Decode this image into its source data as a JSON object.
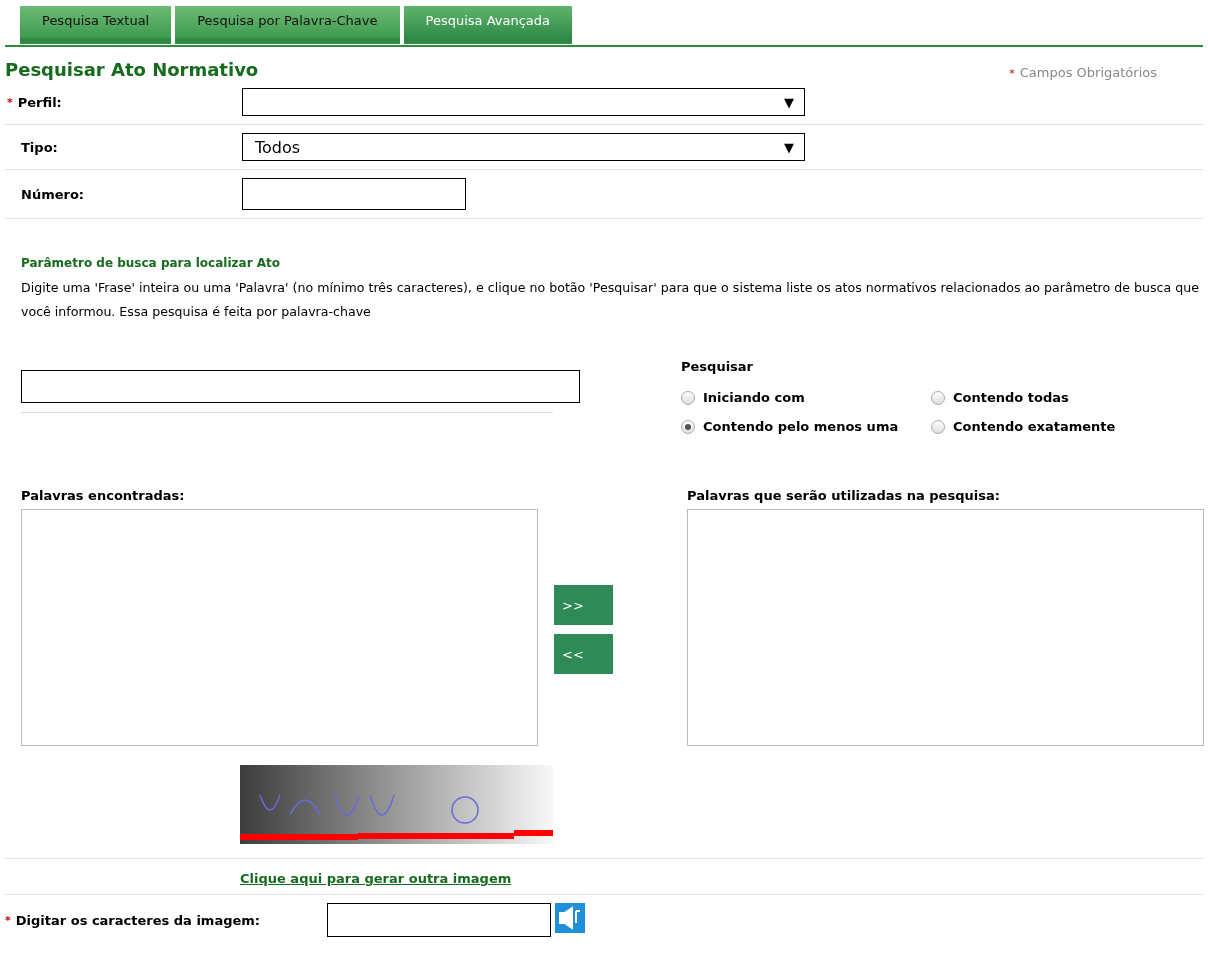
{
  "tabs": [
    {
      "label": "Pesquisa Textual",
      "selected": false
    },
    {
      "label": "Pesquisa por Palavra-Chave",
      "selected": false
    },
    {
      "label": "Pesquisa Avançada",
      "selected": true
    }
  ],
  "title": "Pesquisar Ato Normativo",
  "required_note": {
    "mark": "*",
    "text": "Campos Obrigatórios"
  },
  "fields": [
    {
      "label": "Perfil:",
      "required": true,
      "kind": "select",
      "arrow": "▼"
    },
    {
      "label": "Tipo:",
      "required": false,
      "kind": "select",
      "value": "Todos",
      "arrow": "▼"
    },
    {
      "label": "Número:",
      "required": false,
      "kind": "text"
    }
  ],
  "search_section": {
    "heading": "Parâmetro de busca para localizar Ato",
    "description": "Digite uma 'Frase' inteira ou uma 'Palavra' (no mínimo três caracteres), e clique no botão 'Pesquisar' para que o sistema liste os atos normativos relacionados ao parâmetro de busca que você informou. Essa pesquisa é feita por palavra-chave"
  },
  "search_mode": {
    "title": "Pesquisar",
    "options": [
      {
        "label": "Iniciando com",
        "selected": false
      },
      {
        "label": "Contendo todas",
        "selected": false
      },
      {
        "label": "Contendo pelo menos uma",
        "selected": true
      },
      {
        "label": "Contendo exatamente",
        "selected": false
      }
    ]
  },
  "found_words": {
    "label": "Palavras encontradas:"
  },
  "move_buttons": [
    ">>",
    "<<"
  ],
  "used_words": {
    "label": "Palavras que serão utilizadas na pesquisa:"
  },
  "captcha": {
    "refresh_link": "Clique aqui para gerar outra imagem",
    "input_label": "Digitar os caracteres da imagem:",
    "required": true
  }
}
